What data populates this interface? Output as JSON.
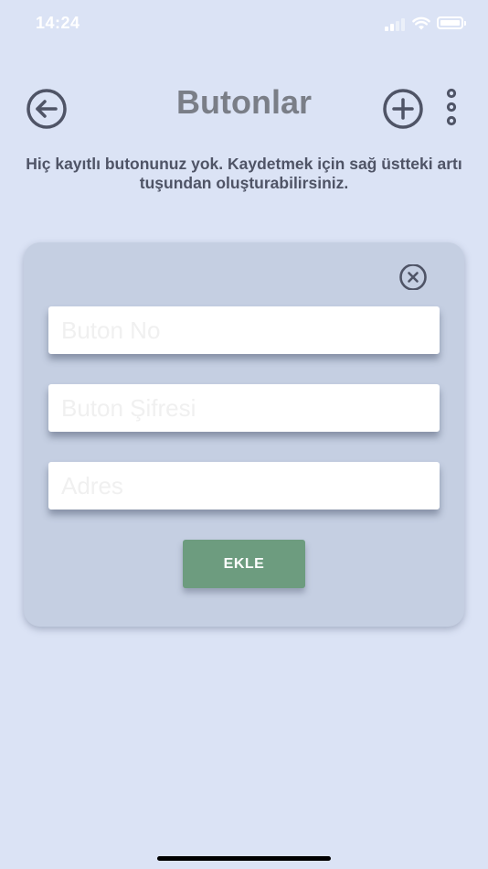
{
  "status_bar": {
    "time": "14:24",
    "icons": [
      "cellular-signal-icon",
      "wifi-icon",
      "battery-icon"
    ],
    "color": "#ffffff"
  },
  "header": {
    "title": "Butonlar",
    "back_icon": "arrow-left-circle-icon",
    "add_icon": "plus-circle-icon",
    "more_icon": "vertical-dots-icon"
  },
  "empty_message": "Hiç kayıtlı butonunuz yok. Kaydetmek için sağ üstteki artı tuşundan oluşturabilirsiniz.",
  "form": {
    "close_icon": "close-circle-icon",
    "fields": [
      {
        "placeholder": "Buton No",
        "value": ""
      },
      {
        "placeholder": "Buton Şifresi",
        "value": ""
      },
      {
        "placeholder": "Adres",
        "value": ""
      }
    ],
    "submit_label": "EKLE"
  },
  "colors": {
    "background": "#dbe3f5",
    "card": "#c5cfe2",
    "title": "#7a7e87",
    "icon": "#4f5466",
    "accent_button": "#6d9c7f"
  }
}
